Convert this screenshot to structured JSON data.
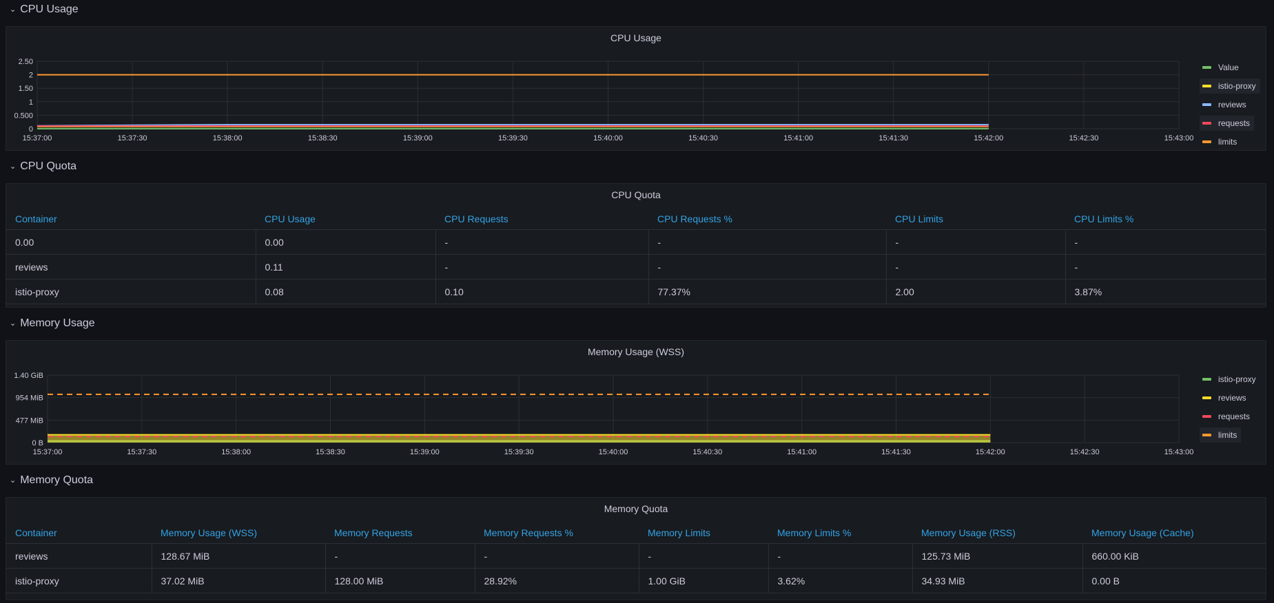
{
  "rows": {
    "cpu_usage": "CPU Usage",
    "cpu_quota": "CPU Quota",
    "memory_usage": "Memory Usage",
    "memory_quota": "Memory Quota"
  },
  "chevron": "chevron-down",
  "cpu_panel": {
    "title": "CPU Usage",
    "legend": [
      {
        "name": "Value",
        "color": "#73bf69"
      },
      {
        "name": "istio-proxy",
        "color": "#fade2a"
      },
      {
        "name": "reviews",
        "color": "#8ab8ff"
      },
      {
        "name": "requests",
        "color": "#f2495c"
      },
      {
        "name": "limits",
        "color": "#ff9830"
      }
    ]
  },
  "cpu_quota_panel": {
    "title": "CPU Quota",
    "columns": [
      "Container",
      "CPU Usage",
      "CPU Requests",
      "CPU Requests %",
      "CPU Limits",
      "CPU Limits %"
    ],
    "rows": [
      [
        "0.00",
        "0.00",
        "-",
        "-",
        "-",
        "-"
      ],
      [
        "reviews",
        "0.11",
        "-",
        "-",
        "-",
        "-"
      ],
      [
        "istio-proxy",
        "0.08",
        "0.10",
        "77.37%",
        "2.00",
        "3.87%"
      ]
    ]
  },
  "mem_panel": {
    "title": "Memory Usage (WSS)",
    "legend": [
      {
        "name": "istio-proxy",
        "color": "#73bf69"
      },
      {
        "name": "reviews",
        "color": "#fade2a"
      },
      {
        "name": "requests",
        "color": "#f2495c"
      },
      {
        "name": "limits",
        "color": "#ff9830"
      }
    ]
  },
  "mem_quota_panel": {
    "title": "Memory Quota",
    "columns": [
      "Container",
      "Memory Usage (WSS)",
      "Memory Requests",
      "Memory Requests %",
      "Memory Limits",
      "Memory Limits %",
      "Memory Usage (RSS)",
      "Memory Usage (Cache)"
    ],
    "rows": [
      [
        "reviews",
        "128.67 MiB",
        "-",
        "-",
        "-",
        "-",
        "125.73 MiB",
        "660.00 KiB"
      ],
      [
        "istio-proxy",
        "37.02 MiB",
        "128.00 MiB",
        "28.92%",
        "1.00 GiB",
        "3.62%",
        "34.93 MiB",
        "0.00 B"
      ]
    ]
  },
  "chart_data": [
    {
      "type": "line",
      "title": "CPU Usage",
      "x": [
        "15:37:00",
        "15:37:30",
        "15:38:00",
        "15:38:30",
        "15:39:00",
        "15:39:30",
        "15:40:00",
        "15:40:30",
        "15:41:00",
        "15:41:30",
        "15:42:00"
      ],
      "x_ticks": [
        "15:37:00",
        "15:37:30",
        "15:38:00",
        "15:38:30",
        "15:39:00",
        "15:39:30",
        "15:40:00",
        "15:40:30",
        "15:41:00",
        "15:41:30",
        "15:42:00",
        "15:42:30",
        "15:43:00"
      ],
      "y_ticks": [
        "0",
        "0.500",
        "1",
        "1.50",
        "2",
        "2.50"
      ],
      "ylim": [
        0,
        2.5
      ],
      "series": [
        {
          "name": "Value",
          "color": "#73bf69",
          "values": [
            0,
            0,
            0,
            0,
            0,
            0,
            0,
            0,
            0,
            0,
            0
          ]
        },
        {
          "name": "istio-proxy",
          "color": "#fade2a",
          "values": [
            0.08,
            0.08,
            0.08,
            0.08,
            0.08,
            0.08,
            0.08,
            0.08,
            0.08,
            0.08,
            0.08
          ]
        },
        {
          "name": "reviews",
          "color": "#8ab8ff",
          "values": [
            0.11,
            0.13,
            0.15,
            0.15,
            0.15,
            0.15,
            0.15,
            0.15,
            0.15,
            0.15,
            0.15
          ]
        },
        {
          "name": "requests",
          "color": "#f2495c",
          "values": [
            0.1,
            0.1,
            0.1,
            0.1,
            0.1,
            0.1,
            0.1,
            0.1,
            0.1,
            0.1,
            0.1
          ]
        },
        {
          "name": "limits",
          "color": "#ff9830",
          "values": [
            2,
            2,
            2,
            2,
            2,
            2,
            2,
            2,
            2,
            2,
            2
          ]
        }
      ]
    },
    {
      "type": "line",
      "title": "Memory Usage (WSS)",
      "x": [
        "15:37:00",
        "15:37:30",
        "15:38:00",
        "15:38:30",
        "15:39:00",
        "15:39:30",
        "15:40:00",
        "15:40:30",
        "15:41:00",
        "15:41:30",
        "15:42:00"
      ],
      "x_ticks": [
        "15:37:00",
        "15:37:30",
        "15:38:00",
        "15:38:30",
        "15:39:00",
        "15:39:30",
        "15:40:00",
        "15:40:30",
        "15:41:00",
        "15:41:30",
        "15:42:00",
        "15:42:30",
        "15:43:00"
      ],
      "y_ticks": [
        "0 B",
        "477 MiB",
        "954 MiB",
        "1.40 GiB"
      ],
      "ylim_mib": [
        0,
        1431
      ],
      "series": [
        {
          "name": "istio-proxy",
          "color": "#73bf69",
          "values_mib": [
            37,
            37,
            37,
            37,
            37,
            37,
            37,
            37,
            37,
            37,
            37
          ]
        },
        {
          "name": "reviews",
          "color": "#fade2a",
          "values_mib": [
            166,
            166,
            166,
            166,
            166,
            166,
            166,
            166,
            166,
            166,
            166
          ]
        },
        {
          "name": "requests",
          "color": "#f2495c",
          "dashed": true,
          "values_mib": [
            128,
            128,
            128,
            128,
            128,
            128,
            128,
            128,
            128,
            128,
            128
          ]
        },
        {
          "name": "limits",
          "color": "#ff9830",
          "dashed": true,
          "values_mib": [
            1024,
            1024,
            1024,
            1024,
            1024,
            1024,
            1024,
            1024,
            1024,
            1024,
            1024
          ]
        }
      ]
    }
  ]
}
